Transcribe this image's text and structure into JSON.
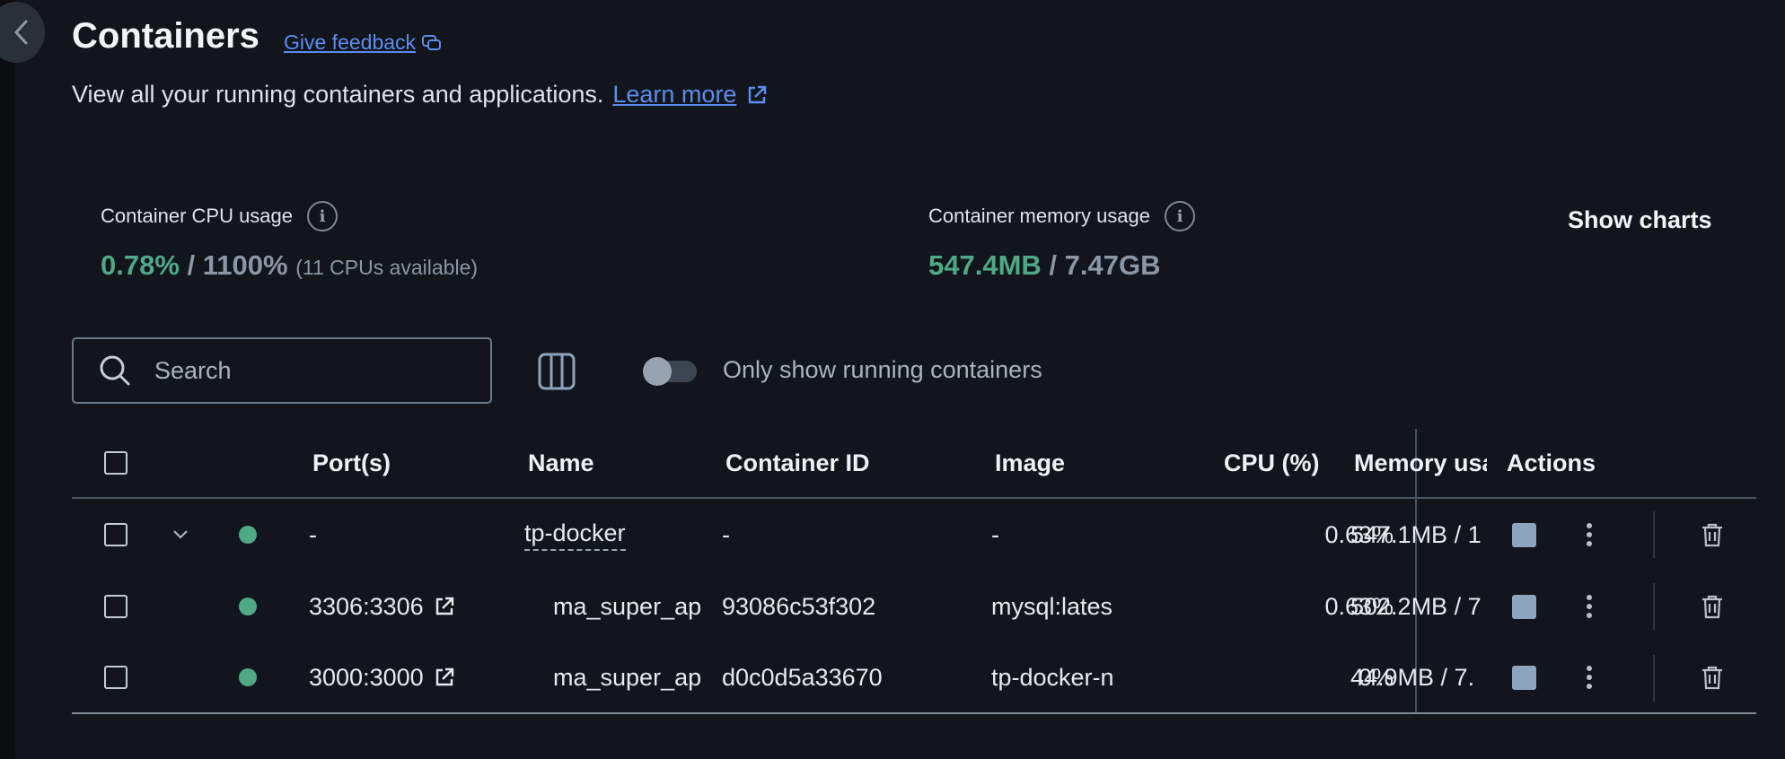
{
  "page": {
    "title": "Containers",
    "feedback_link": "Give feedback",
    "subtitle": "View all your running containers and applications.",
    "learn_more": "Learn more"
  },
  "stats": {
    "cpu": {
      "label": "Container CPU usage",
      "used": "0.78%",
      "separator": " / ",
      "total": "1100%",
      "note": "(11 CPUs available)"
    },
    "memory": {
      "label": "Container memory usage",
      "used": "547.4MB",
      "separator": " / ",
      "total": "7.47GB"
    },
    "show_charts": "Show charts"
  },
  "toolbar": {
    "search_placeholder": "Search",
    "toggle_label": "Only show running containers",
    "toggle_on": false
  },
  "table": {
    "headers": {
      "ports": "Port(s)",
      "name": "Name",
      "container_id": "Container ID",
      "image": "Image",
      "cpu": "CPU (%)",
      "memory": "Memory usa",
      "actions": "Actions"
    },
    "rows": [
      {
        "ports": "-",
        "name": "tp-docker",
        "container_id": "-",
        "image": "-",
        "cpu": "0.63%",
        "memory": "547.1MB / 1"
      },
      {
        "ports": "3306:3306",
        "name": "ma_super_ap",
        "container_id": "93086c53f302",
        "image": "mysql:lates",
        "cpu": "0.63%",
        "memory": "502.2MB / 7"
      },
      {
        "ports": "3000:3000",
        "name": "ma_super_ap",
        "container_id": "d0c0d5a33670",
        "image": "tp-docker-n",
        "cpu": "0%",
        "memory": "44.9MB / 7."
      }
    ]
  },
  "colors": {
    "background": "#12151b",
    "accent_link": "#5b8def",
    "running_green": "#4fa886",
    "muted": "#8b96a6"
  }
}
